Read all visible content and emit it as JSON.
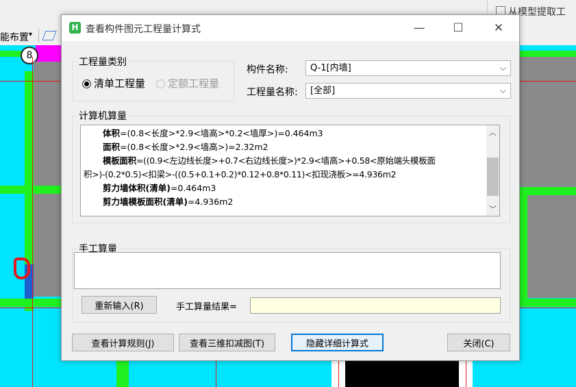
{
  "background": {
    "toolbar_label": "能布置",
    "right_button_label": "从模型提取工",
    "grid_marker": "8"
  },
  "dialog": {
    "title": "查看构件图元工程量计算式",
    "window_controls": {
      "minimize": "—",
      "maximize": "☐",
      "close": "✕"
    },
    "quantity_type": {
      "group_label": "工程量类别",
      "options": [
        {
          "label": "清单工程量",
          "selected": true,
          "enabled": true
        },
        {
          "label": "定额工程量",
          "selected": false,
          "enabled": false
        }
      ]
    },
    "component_name": {
      "label": "构件名称:",
      "value": "Q-1[内墙]"
    },
    "quantity_name": {
      "label": "工程量名称:",
      "value": "[全部]"
    },
    "computer_calc": {
      "group_label": "计算机算量",
      "lines": [
        {
          "bold": "体积",
          "text": "=(0.8<长度>*2.9<墙高>*0.2<墙厚>)=0.464m3"
        },
        {
          "bold": "面积",
          "text": "=(0.8<长度>*2.9<墙高>)=2.32m2"
        },
        {
          "bold": "模板面积",
          "text": "=((0.9<左边线长度>+0.7<右边线长度>)*2.9<墙高>+0.58<原始端头模板面"
        },
        {
          "bold": "",
          "text": "积>)-(0.2*0.5)<扣梁>-((0.5+0.1+0.2)*0.12+0.8*0.11)<扣现浇板>=4.936m2"
        },
        {
          "bold": "剪力墙体积(清单)",
          "text": "=0.464m3"
        },
        {
          "bold": "剪力墙模板面积(清单)",
          "text": "=4.936m2"
        }
      ]
    },
    "manual_calc": {
      "group_label": "手工算量",
      "input_value": "",
      "reenter_button": "重新输入(R)",
      "result_label": "手工算量结果=",
      "result_value": ""
    },
    "buttons": {
      "view_rules": "查看计算规则(J)",
      "view_3d": "查看三维扣减图(T)",
      "hide_detail": "隐藏详细计算式",
      "close": "关闭(C)"
    },
    "colors": {
      "app_icon": "#2fb34a",
      "focus_border": "#0078d7",
      "result_bg": "#ffffe1"
    }
  }
}
